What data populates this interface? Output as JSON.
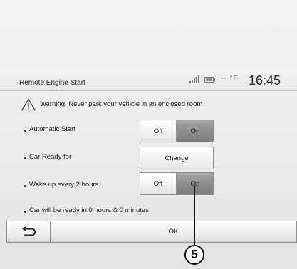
{
  "header": {
    "title": "Remote Engine Start",
    "temperature": "-- °F",
    "time": "16:45"
  },
  "warning": {
    "text": "Warning: Never park your vehicle in an enclosed room"
  },
  "settings": [
    {
      "label": "Automatic Start",
      "off_label": "Off",
      "on_label": "On",
      "selected": "On"
    },
    {
      "label": "Car Ready for",
      "button_label": "Change"
    },
    {
      "label": "Wake up every 2 hours",
      "off_label": "Off",
      "on_label": "On",
      "selected": "On"
    }
  ],
  "status_text": "Car will be ready in 0 hours & 0 minutes",
  "footer": {
    "ok_label": "OK",
    "back_icon": "back-arrow-icon"
  },
  "callout": {
    "number": "5"
  },
  "colors": {
    "selected_toggle": "#8f8f8f",
    "unselected_toggle": "#f2f2f2"
  }
}
